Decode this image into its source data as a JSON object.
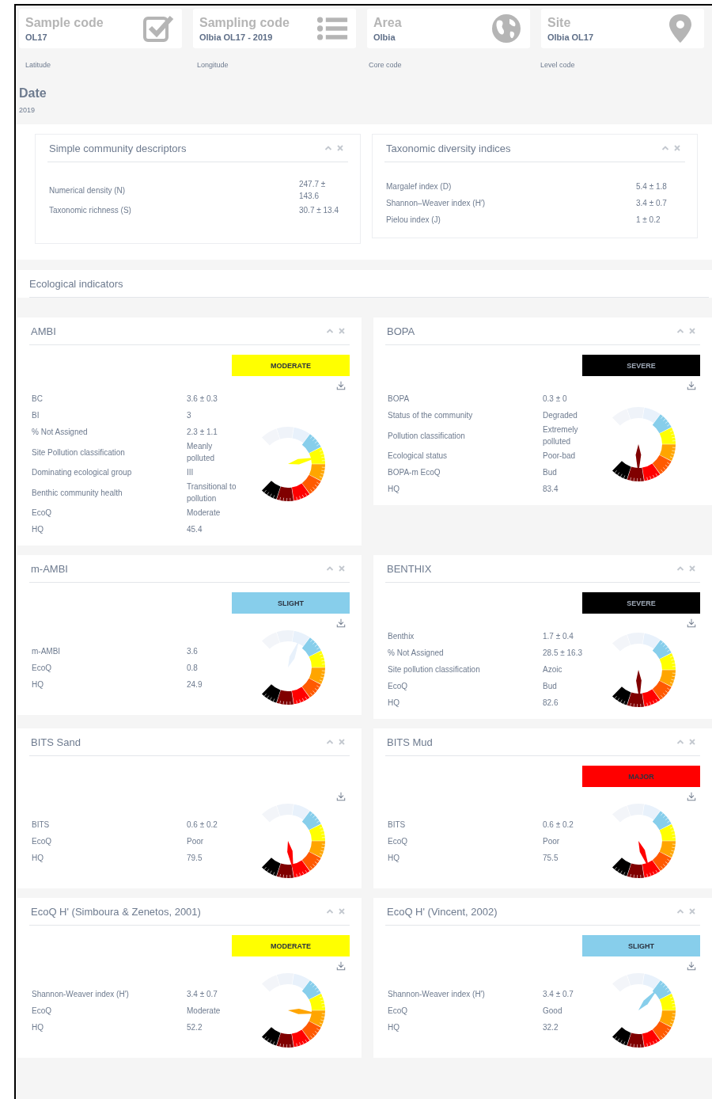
{
  "header_cards": [
    {
      "title": "Sample code",
      "value": "OL17",
      "kind": "checkbox"
    },
    {
      "title": "Sampling code",
      "value": "Olbia OL17 - 2019",
      "kind": "list"
    },
    {
      "title": "Area",
      "value": "Olbia",
      "kind": "globe"
    },
    {
      "title": "Site",
      "value": "Olbia OL17",
      "kind": "pin"
    }
  ],
  "fields": [
    "Latitude",
    "Longitude",
    "Core code",
    "Level code"
  ],
  "date": {
    "title": "Date",
    "value": "2019"
  },
  "descriptor_panels": [
    {
      "title": "Simple community descriptors",
      "rows": [
        {
          "label": "Numerical density (N)",
          "value": "247.7 ± 143.6"
        },
        {
          "label": "Taxonomic richness (S)",
          "value": "30.7 ± 13.4"
        }
      ]
    },
    {
      "title": "Taxonomic diversity indices",
      "rows": [
        {
          "label": "Margalef index (D)",
          "value": "5.4 ± 1.8"
        },
        {
          "label": "Shannon–Weaver index (H′)",
          "value": "3.4 ± 0.7"
        },
        {
          "label": "Pielou index (J)",
          "value": "1 ± 0.2"
        }
      ]
    }
  ],
  "section_title": "Ecological indicators",
  "indicators": [
    {
      "title": "AMBI",
      "badge": {
        "label": "MODERATE",
        "color": "#ffff00"
      },
      "rows": [
        {
          "label": "BC",
          "value": "3.6 ± 0.3"
        },
        {
          "label": "BI",
          "value": "3"
        },
        {
          "label": "% Not Assigned",
          "value": "2.3 ± 1.1"
        },
        {
          "label": "Site Pollution classification",
          "value": "Meanly polluted"
        },
        {
          "label": "Dominating ecological group",
          "value": "III"
        },
        {
          "label": "Benthic community health",
          "value": "Transitional to pollution"
        },
        {
          "label": "EcoQ",
          "value": "Moderate"
        },
        {
          "label": "HQ",
          "value": "45.4"
        }
      ]
    },
    {
      "title": "BOPA",
      "badge": {
        "label": "SEVERE",
        "color": "#000000"
      },
      "rows": [
        {
          "label": "BOPA",
          "value": "0.3 ± 0"
        },
        {
          "label": "Status of the community",
          "value": "Degraded"
        },
        {
          "label": "Pollution classification",
          "value": "Extremely polluted"
        },
        {
          "label": "Ecological status",
          "value": "Poor-bad"
        },
        {
          "label": "BOPA-m EcoQ",
          "value": "Bud"
        },
        {
          "label": "HQ",
          "value": "83.4"
        }
      ]
    },
    {
      "title": "m-AMBI",
      "badge": {
        "label": "SLIGHT",
        "color": "#87ceeb"
      },
      "rows": [
        {
          "label": "m-AMBI",
          "value": "3.6"
        },
        {
          "label": "EcoQ",
          "value": "0.8"
        },
        {
          "label": "HQ",
          "value": "24.9"
        }
      ]
    },
    {
      "title": "BENTHIX",
      "badge": {
        "label": "SEVERE",
        "color": "#000000"
      },
      "rows": [
        {
          "label": "Benthix",
          "value": "1.7 ± 0.4"
        },
        {
          "label": "% Not Assigned",
          "value": "28.5 ± 16.3"
        },
        {
          "label": "Site pollution classification",
          "value": "Azoic"
        },
        {
          "label": "EcoQ",
          "value": "Bud"
        },
        {
          "label": "HQ",
          "value": "82.6"
        }
      ]
    },
    {
      "title": "BITS Sand",
      "rows": [
        {
          "label": "BITS",
          "value": "0.6 ± 0.2"
        },
        {
          "label": "EcoQ",
          "value": "Poor"
        },
        {
          "label": "HQ",
          "value": "79.5"
        }
      ]
    },
    {
      "title": "BITS Mud",
      "badge": {
        "label": "MAJOR",
        "color": "#ff0000"
      },
      "rows": [
        {
          "label": "BITS",
          "value": "0.6 ± 0.2"
        },
        {
          "label": "EcoQ",
          "value": "Poor"
        },
        {
          "label": "HQ",
          "value": "75.5"
        }
      ]
    },
    {
      "title": "EcoQ H' (Simboura & Zenetos, 2001)",
      "badge": {
        "label": "MODERATE",
        "color": "#ffff00"
      },
      "rows": [
        {
          "label": "Shannon-Weaver index (H')",
          "value": "3.4 ± 0.7"
        },
        {
          "label": "EcoQ",
          "value": "Moderate"
        },
        {
          "label": "HQ",
          "value": "52.2"
        }
      ]
    },
    {
      "title": "EcoQ H' (Vincent, 2002)",
      "badge": {
        "label": "SLIGHT",
        "color": "#87ceeb"
      },
      "rows": [
        {
          "label": "Shannon-Weaver index (H')",
          "value": "3.4 ± 0.7"
        },
        {
          "label": "EcoQ",
          "value": "Good"
        },
        {
          "label": "HQ",
          "value": "32.2"
        }
      ]
    }
  ]
}
